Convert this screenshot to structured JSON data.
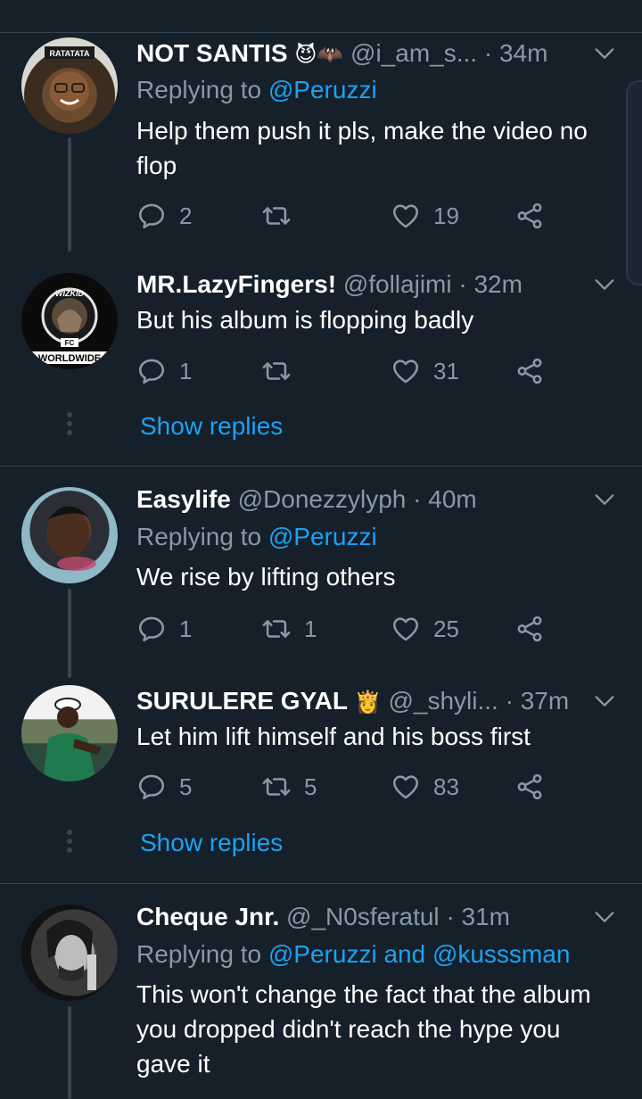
{
  "tweets": [
    {
      "name": "NOT SANTIS",
      "emoji": "😈🦇",
      "handle": "@i_am_s...",
      "time": "· 34m",
      "replying_prefix": "Replying to ",
      "replying_to": "@Peruzzi",
      "text": "Help them push it pls, make the video no flop",
      "replies": "2",
      "retweets": "",
      "likes": "19",
      "avatar_label": "RATATATA"
    },
    {
      "name": "MR.LazyFingers!",
      "handle": "@follajimi",
      "time": "· 32m",
      "text": "But his album is flopping badly",
      "replies": "1",
      "retweets": "",
      "likes": "31",
      "avatar_label_top": "WIZKID",
      "avatar_label_mid": "FC",
      "avatar_label_bottom": "WORLDWIDE",
      "show_replies": "Show replies"
    },
    {
      "name": "Easylife",
      "handle": "@Donezzylyph",
      "time": "· 40m",
      "replying_prefix": "Replying to ",
      "replying_to": "@Peruzzi",
      "text": "We rise by lifting others",
      "replies": "1",
      "retweets": "1",
      "likes": "25"
    },
    {
      "name": "SURULERE GYAL",
      "emoji": "👸",
      "handle": "@_shyli...",
      "time": "· 37m",
      "text": "Let him lift himself and his boss first",
      "replies": "5",
      "retweets": "5",
      "likes": "83",
      "show_replies": "Show replies"
    },
    {
      "name": "Cheque Jnr.",
      "handle": "@_N0sferatul",
      "time": "· 31m",
      "replying_prefix": "Replying to ",
      "replying_to": "@Peruzzi and @kusssman",
      "text": "This won't change the fact that the album you dropped didn't reach the hype you gave it"
    }
  ],
  "colors": {
    "background": "#15202b",
    "text": "#ffffff",
    "muted": "#8899a6",
    "accent": "#1da1f2",
    "border": "#38444d"
  },
  "icons": [
    "reply-icon",
    "retweet-icon",
    "like-icon",
    "share-icon",
    "chevron-down-icon"
  ]
}
